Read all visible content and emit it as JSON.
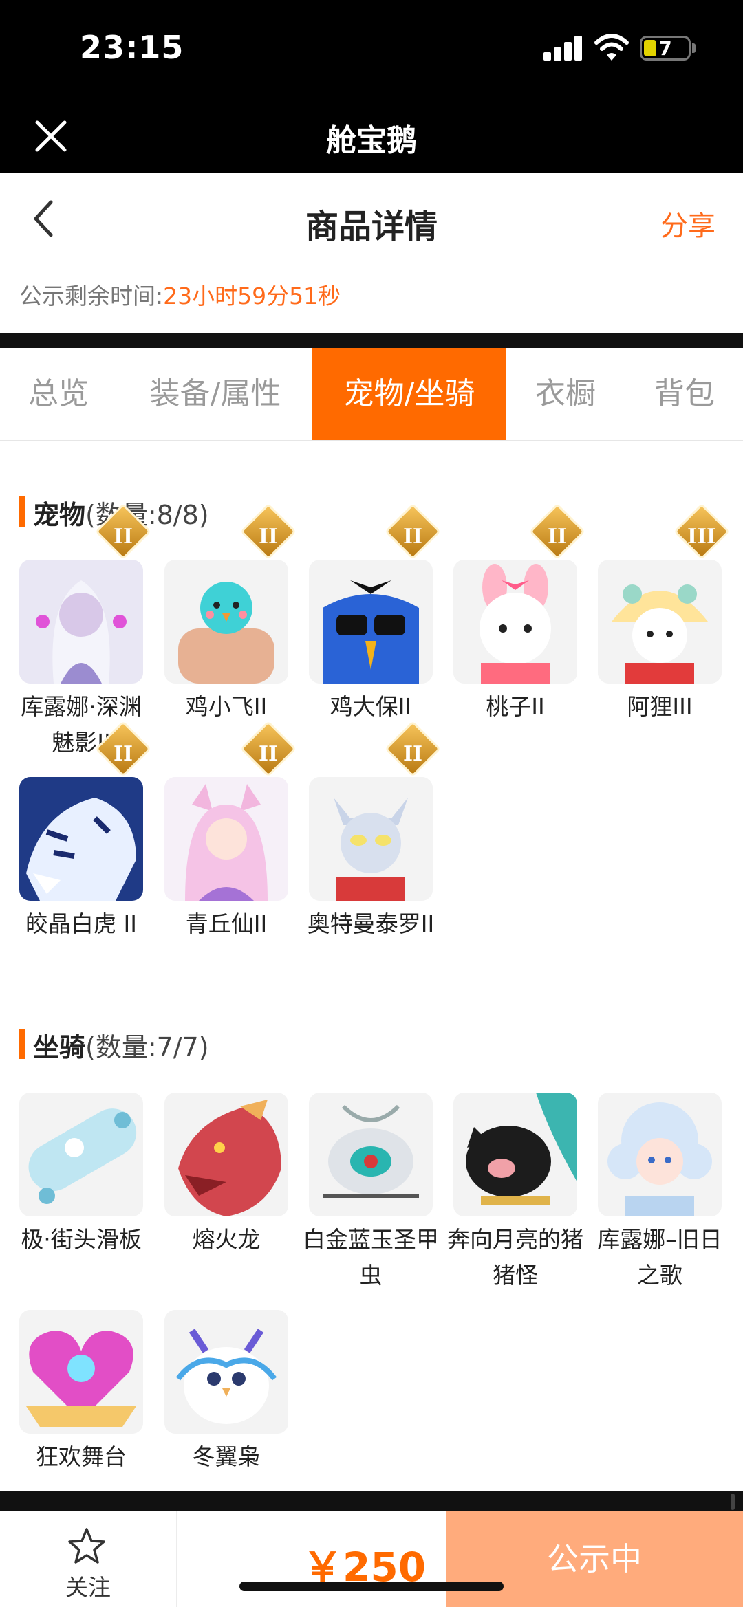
{
  "status_bar": {
    "time": "23:15",
    "battery": "7"
  },
  "app": {
    "title": "舱宝鹅"
  },
  "nav": {
    "title": "商品详情",
    "share": "分享"
  },
  "timer": {
    "label": "公示剩余时间:",
    "value": "23小时59分51秒"
  },
  "tabs": [
    {
      "label": "总览"
    },
    {
      "label": "装备/属性"
    },
    {
      "label": "宠物/坐骑",
      "active": true
    },
    {
      "label": "衣橱"
    },
    {
      "label": "背包"
    }
  ],
  "pets": {
    "title": "宠物",
    "count": "(数量:8/8)",
    "items": [
      {
        "name": "库露娜·深渊魅影II",
        "badge": "II",
        "icon": "pet-white-hair-girl"
      },
      {
        "name": "鸡小飞II",
        "badge": "II",
        "icon": "pet-blue-chick"
      },
      {
        "name": "鸡大保II",
        "badge": "II",
        "icon": "pet-blue-bird-sunglasses"
      },
      {
        "name": "桃子II",
        "badge": "II",
        "icon": "pet-pink-bunny"
      },
      {
        "name": "阿狸III",
        "badge": "III",
        "icon": "pet-lion-hat"
      },
      {
        "name": "皎晶白虎 II",
        "badge": "II",
        "icon": "pet-white-tiger"
      },
      {
        "name": "青丘仙II",
        "badge": "II",
        "icon": "pet-fox-fairy"
      },
      {
        "name": "奥特曼泰罗II",
        "badge": "II",
        "icon": "pet-ultraman-taro"
      }
    ]
  },
  "mounts": {
    "title": "坐骑",
    "count": "(数量:7/7)",
    "items": [
      {
        "name": "极·街头滑板",
        "icon": "mount-skateboard"
      },
      {
        "name": "熔火龙",
        "icon": "mount-red-dragon"
      },
      {
        "name": "白金蓝玉圣甲虫",
        "icon": "mount-beetle"
      },
      {
        "name": "奔向月亮的猪猪怪",
        "icon": "mount-black-pig"
      },
      {
        "name": "库露娜–旧日之歌",
        "icon": "mount-curly-girl"
      },
      {
        "name": "狂欢舞台",
        "icon": "mount-heart-stage"
      },
      {
        "name": "冬翼枭",
        "icon": "mount-snow-owl"
      }
    ]
  },
  "bottom": {
    "follow": "关注",
    "price": "￥250",
    "status": "公示中"
  },
  "colors": {
    "accent": "#ff6a00",
    "status_button": "#ffab7c"
  }
}
